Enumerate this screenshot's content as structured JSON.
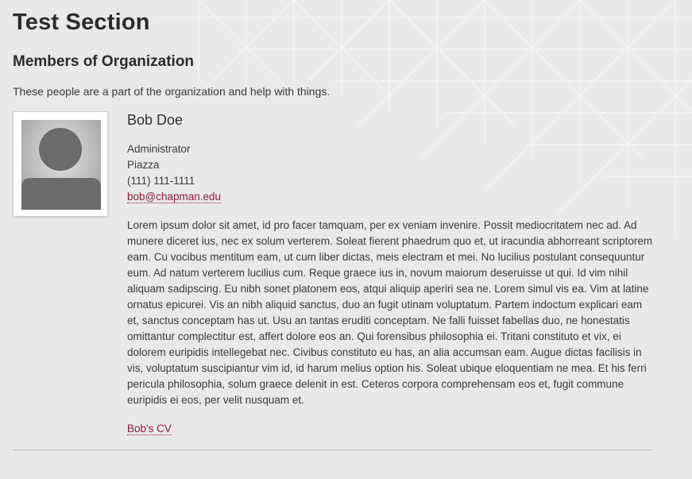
{
  "section": {
    "title": "Test Section",
    "subtitle": "Members of Organization",
    "intro": "These people are a part of the organization and help with things."
  },
  "member": {
    "name": "Bob Doe",
    "role": "Administrator",
    "location": "Piazza",
    "phone": "(111) 111-1111",
    "email": "bob@chapman.edu",
    "bio": "Lorem ipsum dolor sit amet, id pro facer tamquam, per ex veniam invenire. Possit mediocritatem nec ad. Ad munere diceret ius, nec ex solum verterem. Soleat fierent phaedrum quo et, ut iracundia abhorreant scriptorem eam. Cu vocibus mentitum eam, ut cum liber dictas, meis electram et mei.  No lucilius postulant consequuntur eum. Ad natum verterem lucilius cum. Reque graece ius in, novum maiorum deseruisse ut qui. Id vim nihil aliquam sadipscing. Eu nibh sonet platonem eos, atqui aliquip aperiri sea ne. Lorem simul vis ea. Vim at latine ornatus epicurei. Vis an nibh aliquid sanctus, duo an fugit utinam voluptatum. Partem indoctum explicari eam et, sanctus conceptam has ut. Usu an tantas eruditi conceptam. Ne falli fuisset fabellas duo, ne honestatis omittantur complectitur est, affert dolore eos an. Qui forensibus philosophia ei.  Tritani constituto et vix, ei dolorem euripidis intellegebat nec. Civibus constituto eu has, an alia accumsan eam. Augue dictas facilisis in vis, voluptatum suscipiantur vim id, id harum melius option his. Soleat ubique eloquentiam ne mea. Et his ferri pericula philosophia, solum graece delenit in est. Ceteros corpora comprehensam eos et, fugit commune euripidis ei eos, per velit nusquam et.",
    "cv_label": "Bob's CV",
    "photo_icon": "person-placeholder-icon"
  },
  "colors": {
    "background": "#e9e9e9",
    "link": "#8a1c3a",
    "text": "#333333"
  }
}
